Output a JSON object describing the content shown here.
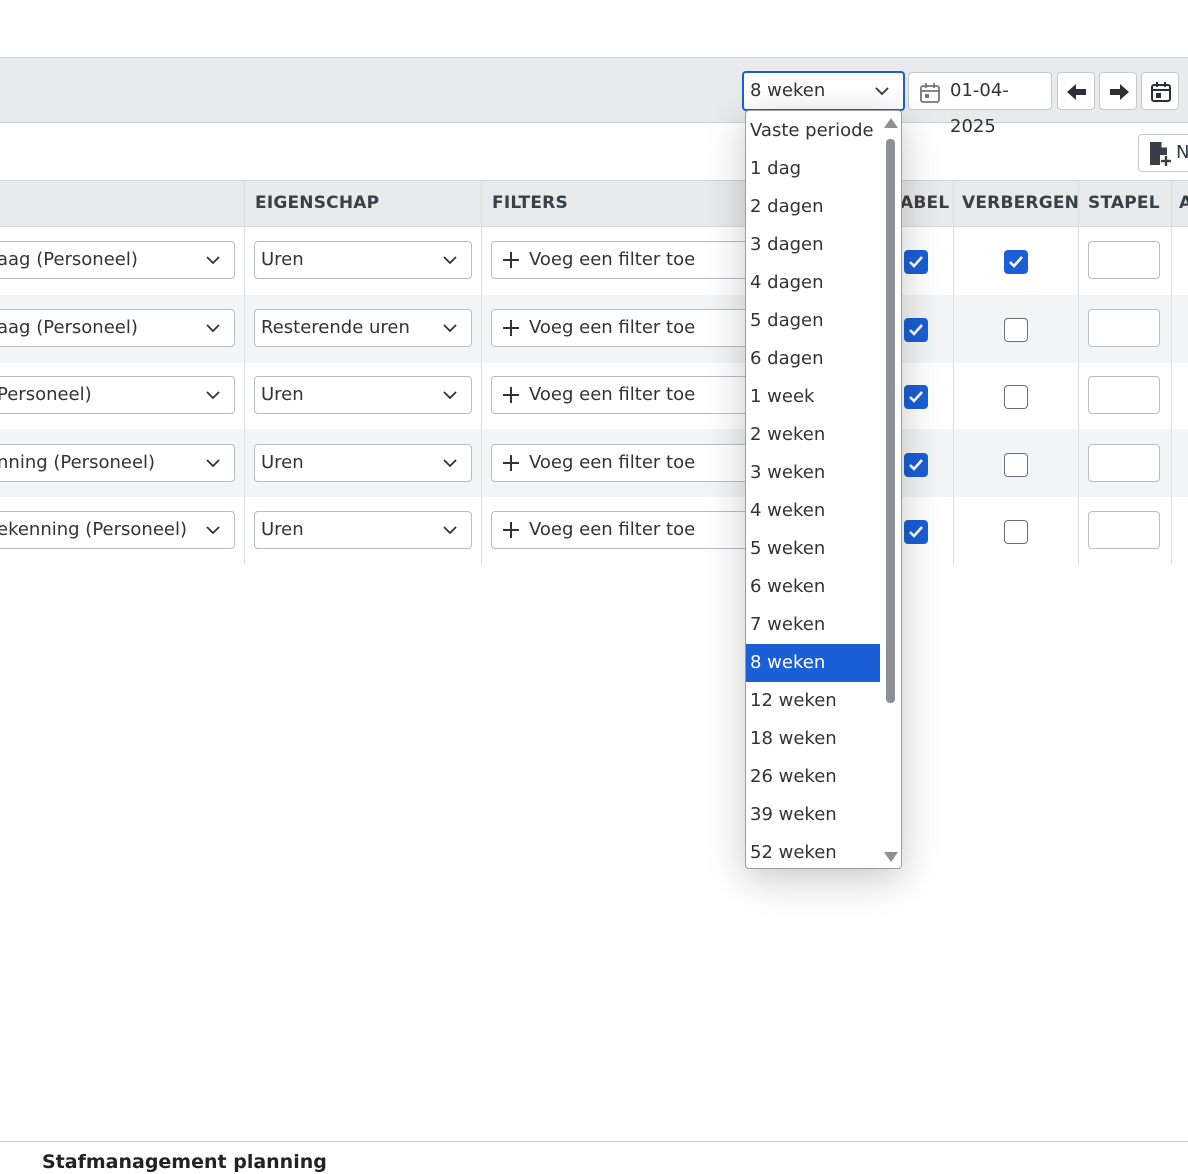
{
  "toolbar": {
    "period_value": "8 weken",
    "date_value": "01-04-2025",
    "new_label": "N"
  },
  "table": {
    "headers": {
      "col_eigenschap": "EIGENSCHAP",
      "col_filters": "FILTERS",
      "col_tabel_partial": "ABEL",
      "col_verbergen": "VERBERGEN",
      "col_stapel": "STAPEL",
      "col_next_partial": "A"
    },
    "rows": [
      {
        "source": "aag (Personeel)",
        "property": "Uren",
        "filter_label": "Voeg een filter toe",
        "tabel_checked": true,
        "verbergen_checked": true
      },
      {
        "source": "aag (Personeel)",
        "property": "Resterende uren",
        "filter_label": "Voeg een filter toe",
        "tabel_checked": true,
        "verbergen_checked": false
      },
      {
        "source": "Personeel)",
        "property": "Uren",
        "filter_label": "Voeg een filter toe",
        "tabel_checked": true,
        "verbergen_checked": false
      },
      {
        "source": "nning (Personeel)",
        "property": "Uren",
        "filter_label": "Voeg een filter toe",
        "tabel_checked": true,
        "verbergen_checked": false
      },
      {
        "source": "ekenning (Personeel)",
        "property": "Uren",
        "filter_label": "Voeg een filter toe",
        "tabel_checked": true,
        "verbergen_checked": false
      }
    ]
  },
  "period_dropdown": {
    "selected": "8 weken",
    "options": [
      "Vaste periode",
      "1 dag",
      "2 dagen",
      "3 dagen",
      "4 dagen",
      "5 dagen",
      "6 dagen",
      "1 week",
      "2 weken",
      "3 weken",
      "4 weken",
      "5 weken",
      "6 weken",
      "7 weken",
      "8 weken",
      "12 weken",
      "18 weken",
      "26 weken",
      "39 weken",
      "52 weken"
    ]
  },
  "footer": {
    "section_title": "Stafmanagement planning"
  },
  "colors": {
    "accent": "#1a5fd6",
    "header_bg": "#e9eaec",
    "row_alt_bg": "#f3f4f5"
  }
}
